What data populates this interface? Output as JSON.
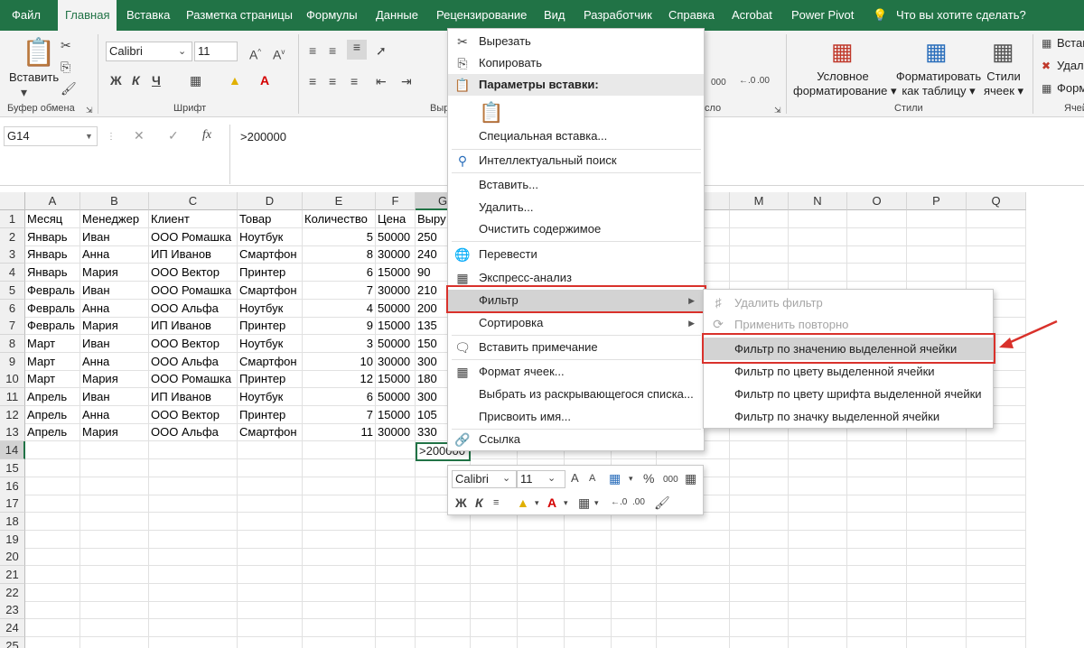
{
  "tabs": [
    "Файл",
    "Главная",
    "Вставка",
    "Разметка страницы",
    "Формулы",
    "Данные",
    "Рецензирование",
    "Вид",
    "Разработчик",
    "Справка",
    "Acrobat",
    "Power Pivot",
    "Что вы хотите сделать?"
  ],
  "ribbon": {
    "paste_label": "Вставить",
    "clipboard_group": "Буфер обмена",
    "font_name": "Calibri",
    "font_size": "11",
    "font_group": "Шрифт",
    "align_group_partial": "Выр",
    "number_group_partial": "сло",
    "number_fmt": "000",
    "cond_format": [
      "Условное",
      "форматирование"
    ],
    "format_table": [
      "Форматировать",
      "как таблицу"
    ],
    "cell_styles": [
      "Стили",
      "ячеек"
    ],
    "styles_group": "Стили",
    "cells_partial": [
      "Вставить",
      "Удал",
      "Форм"
    ],
    "cells_group_partial": "Ячей"
  },
  "formula_bar": {
    "name_box": "G14",
    "formula": ">200000"
  },
  "columns": [
    "A",
    "B",
    "C",
    "D",
    "E",
    "F",
    "G",
    "H",
    "I",
    "J",
    "K",
    "L",
    "M",
    "N",
    "O",
    "P",
    "Q"
  ],
  "rows": [
    [
      "Месяц",
      "Менеджер",
      "Клиент",
      "Товар",
      "Количество",
      "Цена",
      "Выру"
    ],
    [
      "Январь",
      "Иван",
      "ООО Ромашка",
      "Ноутбук",
      "5",
      "50000",
      "250"
    ],
    [
      "Январь",
      "Анна",
      "ИП Иванов",
      "Смартфон",
      "8",
      "30000",
      "240"
    ],
    [
      "Январь",
      "Мария",
      "ООО Вектор",
      "Принтер",
      "6",
      "15000",
      "90"
    ],
    [
      "Февраль",
      "Иван",
      "ООО Ромашка",
      "Смартфон",
      "7",
      "30000",
      "210"
    ],
    [
      "Февраль",
      "Анна",
      "ООО Альфа",
      "Ноутбук",
      "4",
      "50000",
      "200"
    ],
    [
      "Февраль",
      "Мария",
      "ИП Иванов",
      "Принтер",
      "9",
      "15000",
      "135"
    ],
    [
      "Март",
      "Иван",
      "ООО Вектор",
      "Ноутбук",
      "3",
      "50000",
      "150"
    ],
    [
      "Март",
      "Анна",
      "ООО Альфа",
      "Смартфон",
      "10",
      "30000",
      "300"
    ],
    [
      "Март",
      "Мария",
      "ООО Ромашка",
      "Принтер",
      "12",
      "15000",
      "180"
    ],
    [
      "Апрель",
      "Иван",
      "ИП Иванов",
      "Ноутбук",
      "6",
      "50000",
      "300"
    ],
    [
      "Апрель",
      "Анна",
      "ООО Вектор",
      "Принтер",
      "7",
      "15000",
      "105"
    ],
    [
      "Апрель",
      "Мария",
      "ООО Альфа",
      "Смартфон",
      "11",
      "30000",
      "330"
    ]
  ],
  "row_numbers": [
    "1",
    "2",
    "3",
    "4",
    "5",
    "6",
    "7",
    "8",
    "9",
    "10",
    "11",
    "12",
    "13",
    "14",
    "15",
    "16",
    "17",
    "18",
    "19",
    "20",
    "21",
    "22",
    "23",
    "24",
    "25"
  ],
  "active_cell_value": ">200000",
  "context_menu": {
    "items": [
      "Вырезать",
      "Копировать",
      "Параметры вставки:",
      "Специальная вставка...",
      "Интеллектуальный поиск",
      "Вставить...",
      "Удалить...",
      "Очистить содержимое",
      "Перевести",
      "Экспресс-анализ",
      "Фильтр",
      "Сортировка",
      "Вставить примечание",
      "Формат ячеек...",
      "Выбрать из раскрывающегося списка...",
      "Присвоить имя...",
      "Ссылка"
    ]
  },
  "filter_submenu": {
    "items": [
      "Удалить фильтр",
      "Применить повторно",
      "Фильтр по значению выделенной ячейки",
      "Фильтр по цвету выделенной ячейки",
      "Фильтр по цвету шрифта выделенной ячейки",
      "Фильтр по значку выделенной ячейки"
    ]
  },
  "mini_toolbar": {
    "font": "Calibri",
    "size": "11",
    "pct": "%",
    "num": "000"
  },
  "colors": {
    "excel_green": "#217346",
    "highlight_red": "#d9312b",
    "menu_hover": "#d3d3d3"
  }
}
